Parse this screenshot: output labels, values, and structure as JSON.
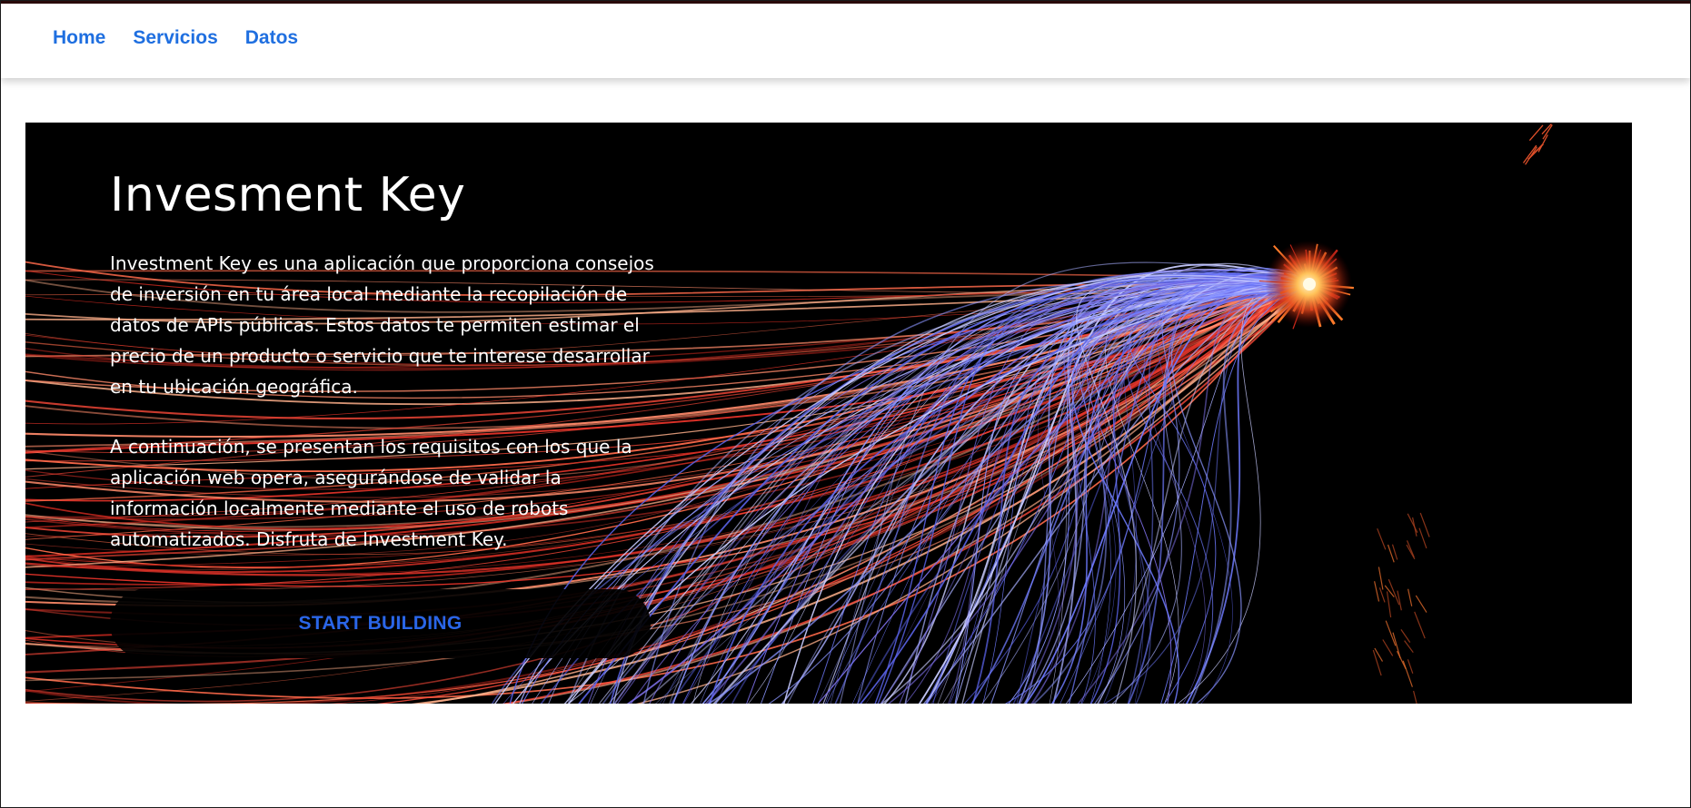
{
  "nav": {
    "items": [
      {
        "label": "Home"
      },
      {
        "label": "Servicios"
      },
      {
        "label": "Datos"
      }
    ]
  },
  "hero": {
    "title": "Invesment Key",
    "paragraph_1": "Investment Key es una aplicación que proporciona consejos de inversión en tu área local mediante la recopilación de datos de APIs públicas. Estos datos te permiten estimar el precio de un producto o servicio que te interese desarrollar en tu ubicación geográfica.",
    "paragraph_2": "A continuación, se presentan los requisitos con los que la aplicación web opera, asegurándose de validar la información localmente mediante el uso de robots automatizados. Disfruta de Investment Key.",
    "cta_label": "START BUILDING",
    "background_image": "light-trails-fiber-optic-burst"
  },
  "colors": {
    "nav_link": "#1f6fe0",
    "cta_text": "#2a66e8",
    "hero_background": "#000000",
    "blue_trail": "#7b86ff",
    "red_trail": "#ff4a3a",
    "burst_core": "#ffd27a"
  }
}
